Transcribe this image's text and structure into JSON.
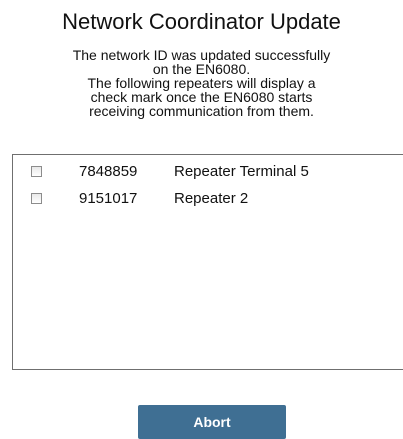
{
  "title": "Network Coordinator Update",
  "message_lines": [
    "The network ID was updated successfully",
    "on the EN6080.",
    "The following repeaters will display a",
    "check mark once the EN6080 starts",
    "receiving communication from them."
  ],
  "repeaters": [
    {
      "id": "7848859",
      "name": "Repeater Terminal 5",
      "checked": false
    },
    {
      "id": "9151017",
      "name": "Repeater 2",
      "checked": false
    }
  ],
  "abort_label": "Abort",
  "colors": {
    "button_bg": "#3f6f93",
    "button_text": "#ffffff"
  }
}
